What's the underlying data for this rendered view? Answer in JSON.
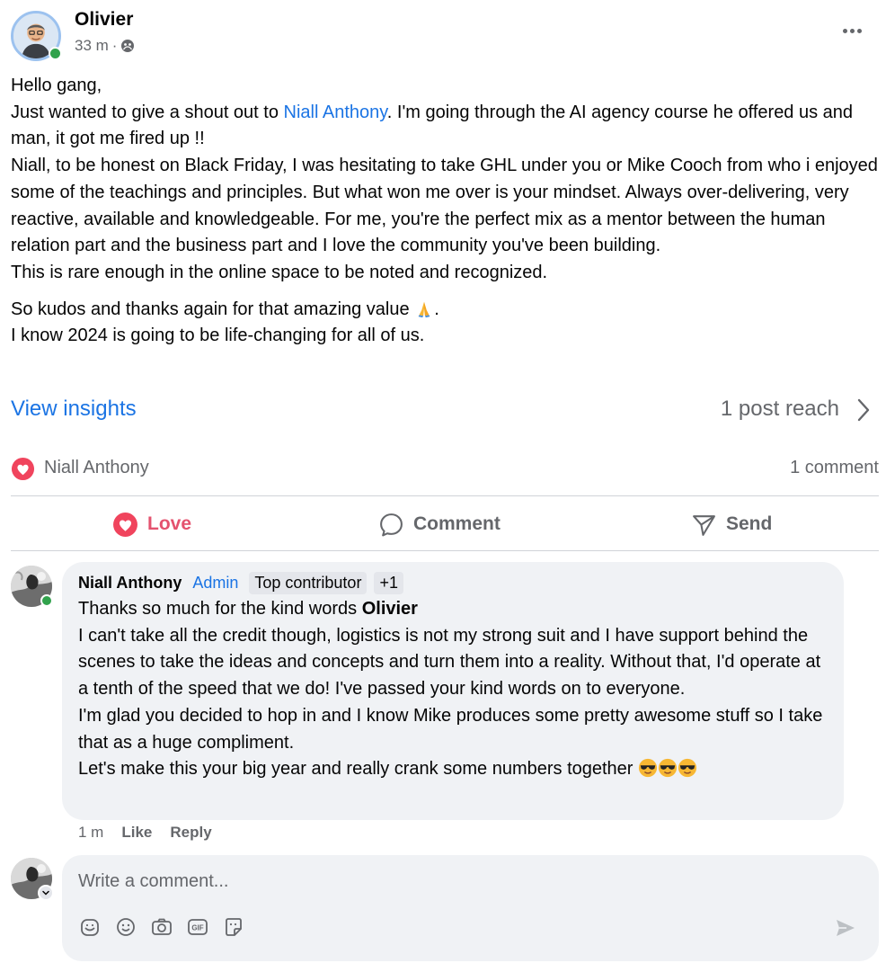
{
  "post": {
    "author": "Olivier",
    "time": "33 m",
    "time_separator": "·",
    "body": {
      "line1": "Hello gang,",
      "line2_before": "Just wanted to give a shout out to ",
      "mention": "Niall Anthony",
      "line2_after": ". I'm going through the AI agency course he offered us and man, it got me fired up !!",
      "para3": "Niall, to be honest on Black Friday, I was hesitating to take GHL under you or Mike Cooch from who i enjoyed some of the teachings and principles. But what won me over is your mindset. Always over-delivering, very reactive, available and knowledgeable. For me, you're the perfect mix as a mentor between the human relation part and the business part and I love the community you've been building.",
      "para4": "This is rare enough in the online space to be noted and recognized.",
      "kudos_before": "So kudos and thanks again for that amazing value ",
      "kudos_after": ".",
      "last_line": "I know 2024 is going to be life-changing for all of us."
    }
  },
  "insights": {
    "view_label": "View insights",
    "reach_label": "1 post reach"
  },
  "summary": {
    "reactor": "Niall Anthony",
    "comment_count": "1 comment"
  },
  "actions": {
    "love": "Love",
    "comment": "Comment",
    "send": "Send"
  },
  "comment": {
    "author": "Niall Anthony",
    "admin_badge": "Admin",
    "contributor_badge": "Top contributor",
    "extra_badge": "+1",
    "line1_before": "Thanks so much for the kind words ",
    "line1_bold": "Olivier",
    "para2": "I can't take all the credit though, logistics is not my strong suit and I have support behind the scenes to take the ideas and concepts and turn them into a reality. Without that, I'd operate at a tenth of the speed that we do! I've passed your kind words on to everyone.",
    "para3": "I'm glad you decided to hop in and I know Mike produces some pretty awesome stuff so I take that as a huge compliment.",
    "para4": "Let's make this your big year and really crank some numbers together ",
    "time": "1 m",
    "like": "Like",
    "reply": "Reply"
  },
  "composer": {
    "placeholder": "Write a comment..."
  },
  "icons": {
    "globe": "globe-icon",
    "more": "more-horizontal-icon",
    "chevron": "chevron-right-icon",
    "love": "heart-icon",
    "comment": "speech-bubble-icon",
    "send": "paper-plane-icon",
    "sticker": "sticker-icon",
    "emoji": "smiley-icon",
    "camera": "camera-icon",
    "gif": "gif-icon",
    "avatar_sticker": "avatar-sticker-icon",
    "submit": "send-arrow-icon"
  },
  "colors": {
    "link": "#1b74e4",
    "love": "#e4526e",
    "muted": "#65676b",
    "bubble": "#f0f2f5",
    "online": "#31a24c"
  }
}
